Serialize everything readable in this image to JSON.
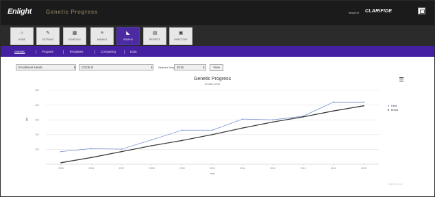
{
  "app": {
    "logo": "Enlight",
    "module_title": "Genetic Progress",
    "vendor_prefix": "brand of",
    "vendor_brand": "CLARIFIDE",
    "window_button_icon": "window-restore-icon"
  },
  "toolbar": {
    "items": [
      {
        "label": "HOME",
        "icon": "home-icon",
        "glyph": "⌂",
        "active": false
      },
      {
        "label": "SETTINGS",
        "icon": "wrench-icon",
        "glyph": "✎",
        "active": false
      },
      {
        "label": "SCHEDULE",
        "icon": "calendar-icon",
        "glyph": "▦",
        "active": false
      },
      {
        "label": "ANIMALS",
        "icon": "list-icon",
        "glyph": "≡",
        "active": false
      },
      {
        "label": "GRAPHS",
        "icon": "chart-icon",
        "glyph": "◣",
        "active": true
      },
      {
        "label": "REPORTS",
        "icon": "report-icon",
        "glyph": "▤",
        "active": false
      },
      {
        "label": "DIRECTORY",
        "icon": "folder-icon",
        "glyph": "▣",
        "active": false
      }
    ]
  },
  "subtabs": {
    "items": [
      "Genetic",
      "Program",
      "Templates",
      "Comparing",
      "Data"
    ],
    "active_index": 0
  },
  "filters": {
    "herd": "Enrollment Herds",
    "trait": "CDCB $",
    "year_label": "Select a Year",
    "year": "2015",
    "view_label": "View"
  },
  "chart_data": {
    "type": "line",
    "title": "Genetic Progress",
    "subtitle": "All dairy herds",
    "xlabel": "Year",
    "ylabel": "$",
    "x": [
      "2005",
      "2006",
      "2007",
      "2008",
      "2009",
      "2010",
      "2011",
      "2012",
      "2013",
      "2014",
      "2015"
    ],
    "ylim": [
      0,
      500
    ],
    "yticks": [
      "100",
      "200",
      "300",
      "400",
      "500"
    ],
    "grid": true,
    "legend_position": "right",
    "series": [
      {
        "name": "Herd",
        "color": "#7c95d4",
        "values": [
          85,
          105,
          102,
          165,
          230,
          230,
          305,
          300,
          325,
          420,
          420
        ]
      },
      {
        "name": "Breed",
        "color": "#3a3a3a",
        "values": [
          10,
          45,
          85,
          125,
          160,
          200,
          245,
          285,
          320,
          360,
          395
        ]
      }
    ],
    "credit": "Highcharts.com"
  }
}
